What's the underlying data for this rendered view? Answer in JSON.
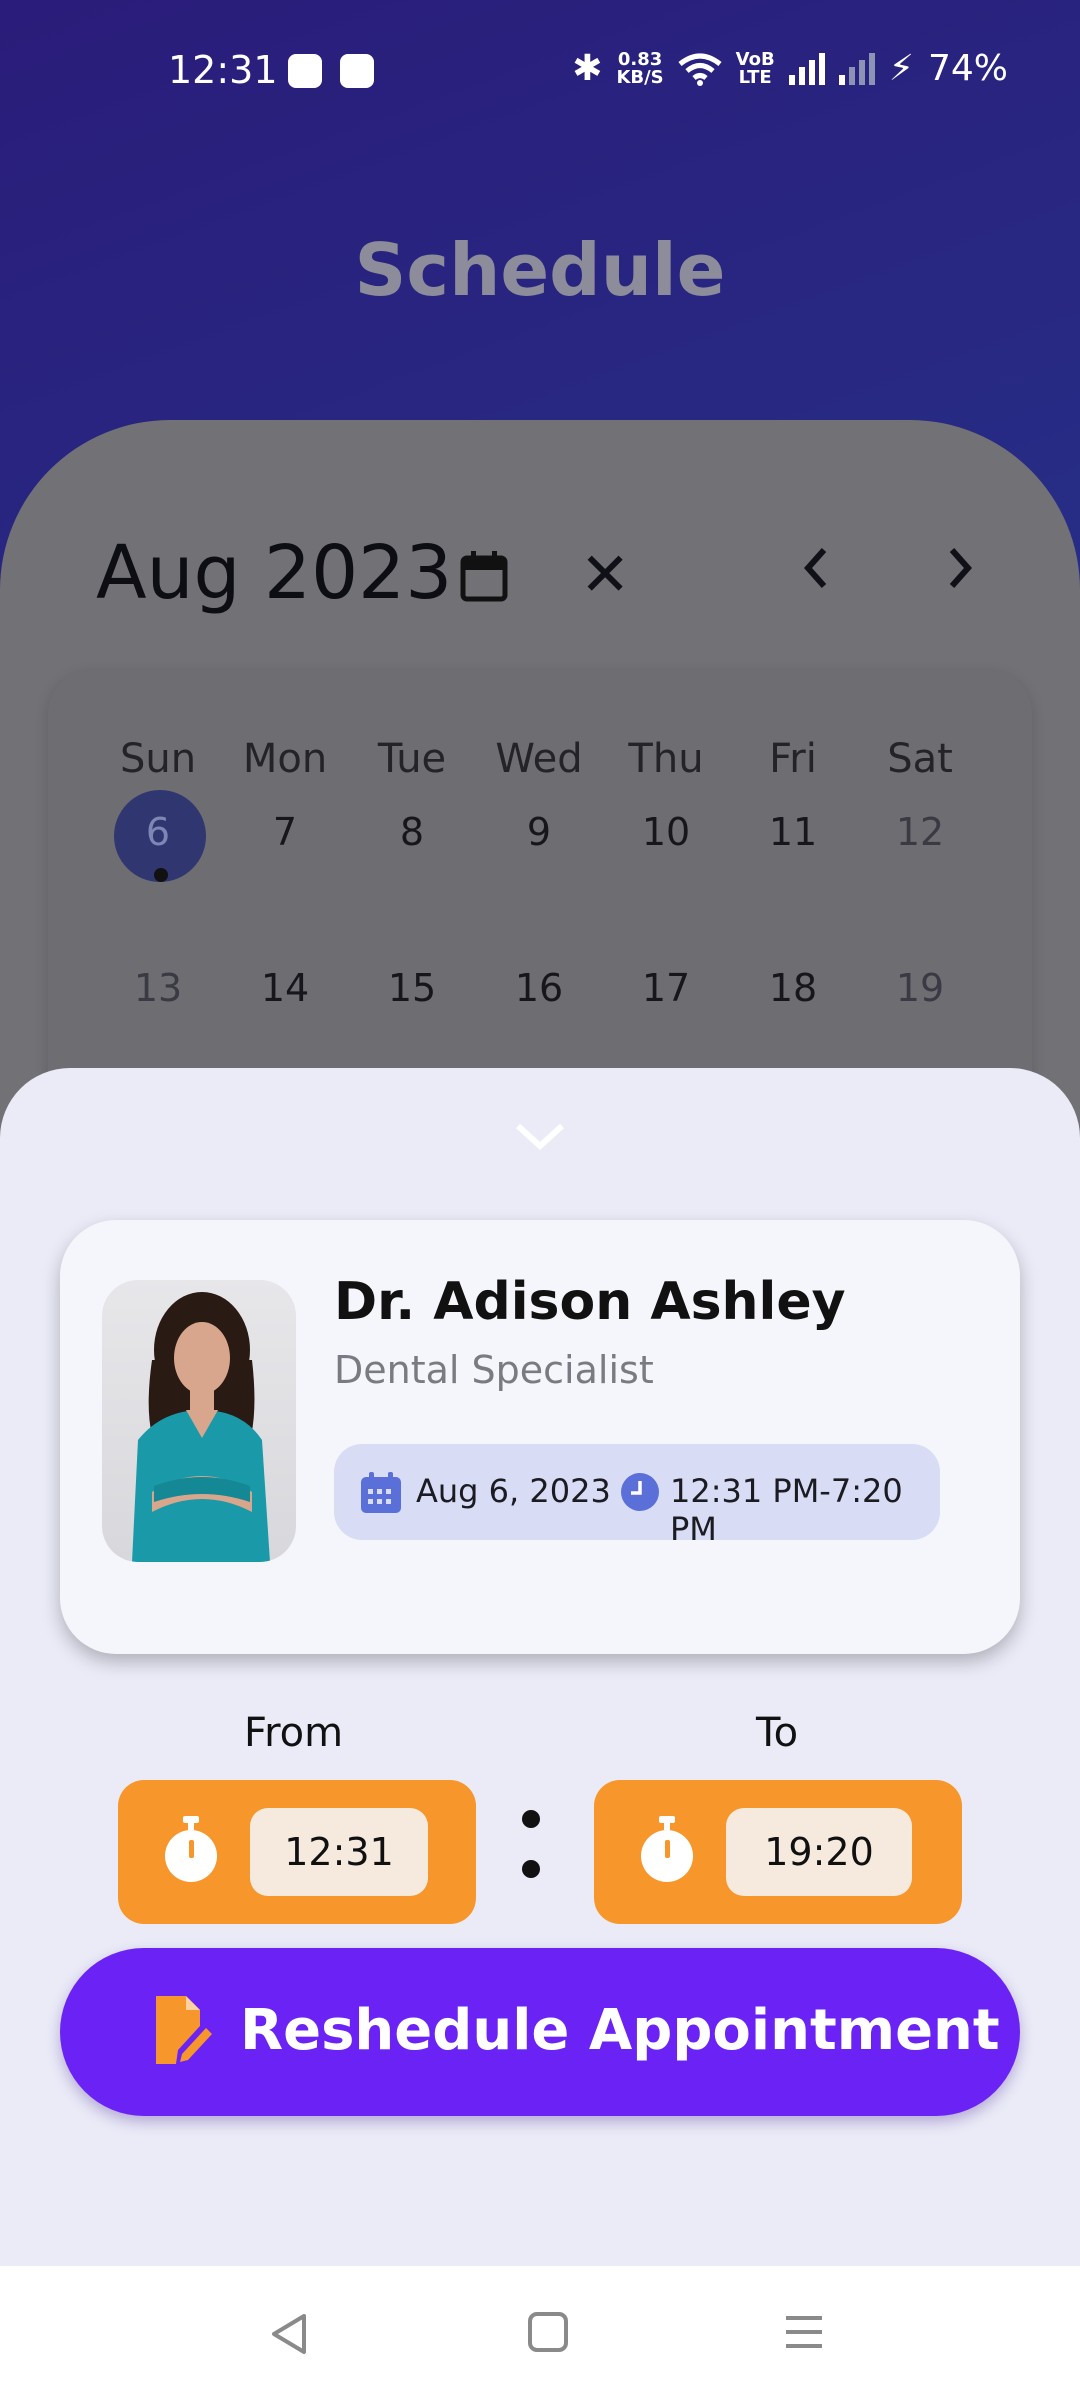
{
  "status_bar": {
    "time": "12:31",
    "net_speed_value": "0.83",
    "net_speed_unit": "KB/S",
    "volte_top": "VoB",
    "volte_bottom": "LTE",
    "battery": "74%"
  },
  "header": {
    "title": "Schedule"
  },
  "calendar": {
    "month_label": "Aug 2023",
    "weekdays": [
      "Sun",
      "Mon",
      "Tue",
      "Wed",
      "Thu",
      "Fri",
      "Sat"
    ],
    "week1": [
      "6",
      "7",
      "8",
      "9",
      "10",
      "11",
      "12"
    ],
    "week2": [
      "13",
      "14",
      "15",
      "16",
      "17",
      "18",
      "19"
    ],
    "selected_day": "6"
  },
  "appointment": {
    "doctor_name": "Dr. Adison Ashley",
    "specialty": "Dental Specialist",
    "date": "Aug 6, 2023",
    "time_range": "12:31 PM-7:20 PM"
  },
  "time_picker": {
    "from_label": "From",
    "to_label": "To",
    "from_value": "12:31",
    "to_value": "19:20"
  },
  "action": {
    "reschedule_label": "Reshedule Appointment"
  },
  "colors": {
    "accent_purple": "#6a22f5",
    "accent_orange": "#f6962b",
    "calendar_selected": "#303770"
  }
}
